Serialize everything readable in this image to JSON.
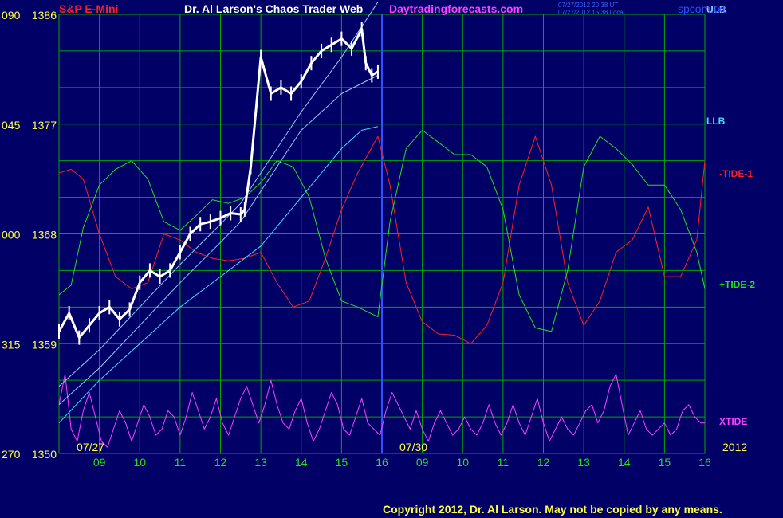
{
  "header": {
    "symbol": "S&P E-Mini",
    "title": "Dr. Al Larson's Chaos Trader Web",
    "site": "Daytradingforecasts.com",
    "stamp_ut": "07/27/2012 20:38 UT",
    "stamp_local": "07/27/2012 15:38 Local",
    "file": "spcom.txt"
  },
  "footer": {
    "copyright": "Copyright 2012, Dr. Al Larson. May not be copied by any means."
  },
  "colors": {
    "background": "#000066",
    "grid": "#00a800",
    "price": "#ffffff",
    "band_upper": "#8ecfff",
    "band_lower": "#40e0ff",
    "tide1": "#ff2020",
    "tide2": "#20e020",
    "xtide": "#ff40ff",
    "divider": "#3050ff",
    "yellow": "#ffff40"
  },
  "chart_data": {
    "type": "line",
    "ylim": [
      1350,
      1386
    ],
    "price_ticks": [
      {
        "price": 1386,
        "left": "090",
        "right": "1386"
      },
      {
        "price": 1377,
        "left": "045",
        "right": "1377"
      },
      {
        "price": 1368,
        "left": "000",
        "right": "1368"
      },
      {
        "price": 1359,
        "left": "315",
        "right": "1359"
      },
      {
        "price": 1350,
        "left": "270",
        "right": "1350"
      }
    ],
    "date_labels": [
      {
        "hour_index": 0,
        "label": "07/27"
      },
      {
        "hour_index": 8,
        "label": "07/30"
      },
      {
        "hour_index": 16,
        "label": "2012"
      }
    ],
    "hour_labels": [
      "09",
      "10",
      "11",
      "12",
      "13",
      "14",
      "15",
      "16",
      "09",
      "10",
      "11",
      "12",
      "13",
      "14",
      "15",
      "16"
    ],
    "line_labels": [
      {
        "name": "ULB",
        "color": "band_upper"
      },
      {
        "name": "LLB",
        "color": "band_lower"
      },
      {
        "name": "-TIDE-1",
        "color": "tide1"
      },
      {
        "name": "+TIDE-2",
        "color": "tide2"
      },
      {
        "name": "XTIDE",
        "color": "xtide"
      }
    ],
    "price_series": {
      "name": "S&P E-Mini",
      "h": [
        0.0,
        0.25,
        0.5,
        0.75,
        1.0,
        1.25,
        1.5,
        1.75,
        2.0,
        2.25,
        2.5,
        2.75,
        3.0,
        3.25,
        3.5,
        3.75,
        4.0,
        4.25,
        4.5,
        4.6,
        4.75,
        5.0,
        5.25,
        5.5,
        5.75,
        6.0,
        6.25,
        6.5,
        6.75,
        7.0,
        7.25,
        7.5,
        7.6,
        7.75,
        7.9
      ],
      "y": [
        1360.0,
        1361.5,
        1359.5,
        1360.5,
        1361.5,
        1362.0,
        1361.0,
        1361.8,
        1364.0,
        1365.0,
        1364.5,
        1365.0,
        1366.5,
        1368.0,
        1368.8,
        1369.0,
        1369.3,
        1369.7,
        1369.6,
        1370.0,
        1373.5,
        1382.5,
        1379.5,
        1380.0,
        1379.5,
        1380.5,
        1382.0,
        1383.0,
        1383.5,
        1384.0,
        1383.2,
        1384.8,
        1382.0,
        1381.0,
        1381.3
      ]
    },
    "upper_band": {
      "name": "ULB",
      "h": [
        0.0,
        1.0,
        2.0,
        3.0,
        4.0,
        4.5,
        5.0,
        6.0,
        7.0,
        7.9
      ],
      "y": [
        1355.5,
        1358.5,
        1362.0,
        1365.5,
        1368.8,
        1370.5,
        1373.0,
        1378.0,
        1382.5,
        1387.0
      ]
    },
    "middle_band": {
      "name": "ULB",
      "h": [
        0.0,
        1.0,
        2.0,
        3.0,
        4.0,
        4.5,
        5.0,
        6.0,
        7.0,
        7.9
      ],
      "y": [
        1354.0,
        1357.0,
        1360.5,
        1364.0,
        1367.3,
        1369.0,
        1371.5,
        1376.5,
        1379.5,
        1381.0
      ]
    },
    "lower_band": {
      "name": "LLB",
      "h": [
        0.0,
        1.0,
        2.0,
        3.0,
        4.0,
        5.0,
        6.0,
        7.0,
        7.5,
        7.9
      ],
      "y": [
        1352.5,
        1356.0,
        1359.0,
        1362.0,
        1364.5,
        1367.0,
        1371.0,
        1375.0,
        1376.5,
        1376.8
      ]
    },
    "tide1": {
      "name": "-TIDE-1",
      "h": [
        0.0,
        0.3,
        0.6,
        1.0,
        1.4,
        1.8,
        2.2,
        2.6,
        3.0,
        3.4,
        3.8,
        4.2,
        4.6,
        5.0,
        5.4,
        5.8,
        6.2,
        6.6,
        7.0,
        7.4,
        7.9,
        8.2,
        8.6,
        9.0,
        9.4,
        9.8,
        10.2,
        10.6,
        11.0,
        11.4,
        11.8,
        12.2,
        12.6,
        13.0,
        13.4,
        13.8,
        14.2,
        14.6,
        15.0,
        15.4,
        15.8,
        16.0
      ],
      "y": [
        1373.0,
        1373.3,
        1372.5,
        1368.0,
        1364.5,
        1363.5,
        1364.0,
        1368.0,
        1367.5,
        1366.5,
        1366.0,
        1365.8,
        1366.0,
        1366.5,
        1364.0,
        1362.0,
        1362.5,
        1366.0,
        1370.0,
        1373.0,
        1376.0,
        1372.0,
        1364.0,
        1360.8,
        1359.8,
        1359.7,
        1359.0,
        1360.5,
        1364.0,
        1372.0,
        1376.0,
        1372.0,
        1364.0,
        1360.5,
        1362.5,
        1366.5,
        1367.5,
        1370.2,
        1364.5,
        1364.5,
        1367.5,
        1374.0
      ]
    },
    "tide2": {
      "name": "+TIDE-2",
      "h": [
        0.0,
        0.3,
        0.6,
        1.0,
        1.4,
        1.8,
        2.2,
        2.6,
        3.0,
        3.4,
        3.8,
        4.2,
        4.6,
        5.0,
        5.4,
        5.8,
        6.2,
        6.6,
        7.0,
        7.4,
        7.9,
        8.2,
        8.6,
        9.0,
        9.4,
        9.8,
        10.2,
        10.6,
        11.0,
        11.4,
        11.8,
        12.2,
        12.6,
        13.0,
        13.4,
        13.8,
        14.2,
        14.6,
        15.0,
        15.4,
        15.8,
        16.0
      ],
      "y": [
        1363.0,
        1363.8,
        1368.5,
        1372.0,
        1373.3,
        1374.0,
        1372.5,
        1369.0,
        1368.3,
        1369.5,
        1370.8,
        1370.5,
        1371.0,
        1372.2,
        1374.0,
        1373.5,
        1371.0,
        1366.0,
        1362.5,
        1362.0,
        1361.2,
        1369.0,
        1375.0,
        1376.5,
        1375.5,
        1374.5,
        1374.5,
        1373.5,
        1370.0,
        1363.0,
        1360.3,
        1360.0,
        1365.0,
        1373.5,
        1376.0,
        1375.0,
        1373.7,
        1372.0,
        1372.0,
        1370.0,
        1366.5,
        1363.5
      ]
    },
    "xtide": {
      "name": "XTIDE",
      "h": [
        0.0,
        0.15,
        0.3,
        0.45,
        0.6,
        0.75,
        0.9,
        1.05,
        1.2,
        1.35,
        1.5,
        1.65,
        1.8,
        1.95,
        2.1,
        2.25,
        2.4,
        2.55,
        2.7,
        2.85,
        3.0,
        3.15,
        3.3,
        3.45,
        3.6,
        3.75,
        3.9,
        4.05,
        4.2,
        4.35,
        4.5,
        4.65,
        4.8,
        4.95,
        5.1,
        5.25,
        5.4,
        5.55,
        5.7,
        5.85,
        6.0,
        6.15,
        6.3,
        6.45,
        6.6,
        6.75,
        6.9,
        7.05,
        7.2,
        7.35,
        7.5,
        7.65,
        7.8,
        7.95,
        8.1,
        8.25,
        8.4,
        8.55,
        8.7,
        8.85,
        9.0,
        9.15,
        9.3,
        9.45,
        9.6,
        9.75,
        9.9,
        10.05,
        10.2,
        10.35,
        10.5,
        10.65,
        10.8,
        10.95,
        11.1,
        11.25,
        11.4,
        11.55,
        11.7,
        11.85,
        12.0,
        12.15,
        12.3,
        12.45,
        12.6,
        12.75,
        12.9,
        13.05,
        13.2,
        13.35,
        13.5,
        13.65,
        13.8,
        13.95,
        14.1,
        14.25,
        14.4,
        14.55,
        14.7,
        14.85,
        15.0,
        15.15,
        15.3,
        15.45,
        15.6,
        15.75,
        15.9,
        16.0
      ],
      "y": [
        1354.0,
        1356.5,
        1352.0,
        1351.0,
        1353.5,
        1355.0,
        1353.0,
        1351.0,
        1350.5,
        1352.0,
        1353.5,
        1352.5,
        1351.0,
        1352.5,
        1354.0,
        1353.0,
        1351.5,
        1352.0,
        1353.5,
        1353.0,
        1351.5,
        1353.0,
        1355.0,
        1353.5,
        1352.0,
        1353.0,
        1354.5,
        1352.5,
        1351.5,
        1353.0,
        1354.5,
        1355.5,
        1354.0,
        1352.5,
        1354.0,
        1356.0,
        1354.0,
        1352.5,
        1352.0,
        1353.5,
        1354.5,
        1352.5,
        1351.0,
        1352.0,
        1353.5,
        1355.0,
        1354.0,
        1352.0,
        1351.5,
        1353.0,
        1354.5,
        1352.5,
        1352.0,
        1351.5,
        1353.5,
        1355.0,
        1354.0,
        1353.0,
        1352.0,
        1353.5,
        1352.0,
        1351.0,
        1352.5,
        1353.5,
        1352.5,
        1351.5,
        1352.0,
        1353.0,
        1352.0,
        1351.5,
        1352.5,
        1354.0,
        1352.5,
        1351.5,
        1352.5,
        1354.0,
        1352.5,
        1351.5,
        1353.0,
        1354.5,
        1352.5,
        1351.0,
        1352.0,
        1353.0,
        1352.0,
        1351.5,
        1352.5,
        1353.5,
        1354.0,
        1352.5,
        1353.5,
        1355.5,
        1356.5,
        1354.0,
        1351.5,
        1352.5,
        1353.5,
        1352.0,
        1351.5,
        1352.0,
        1352.5,
        1351.5,
        1352.0,
        1353.5,
        1354.0,
        1353.0,
        1352.5,
        1352.5
      ]
    }
  }
}
